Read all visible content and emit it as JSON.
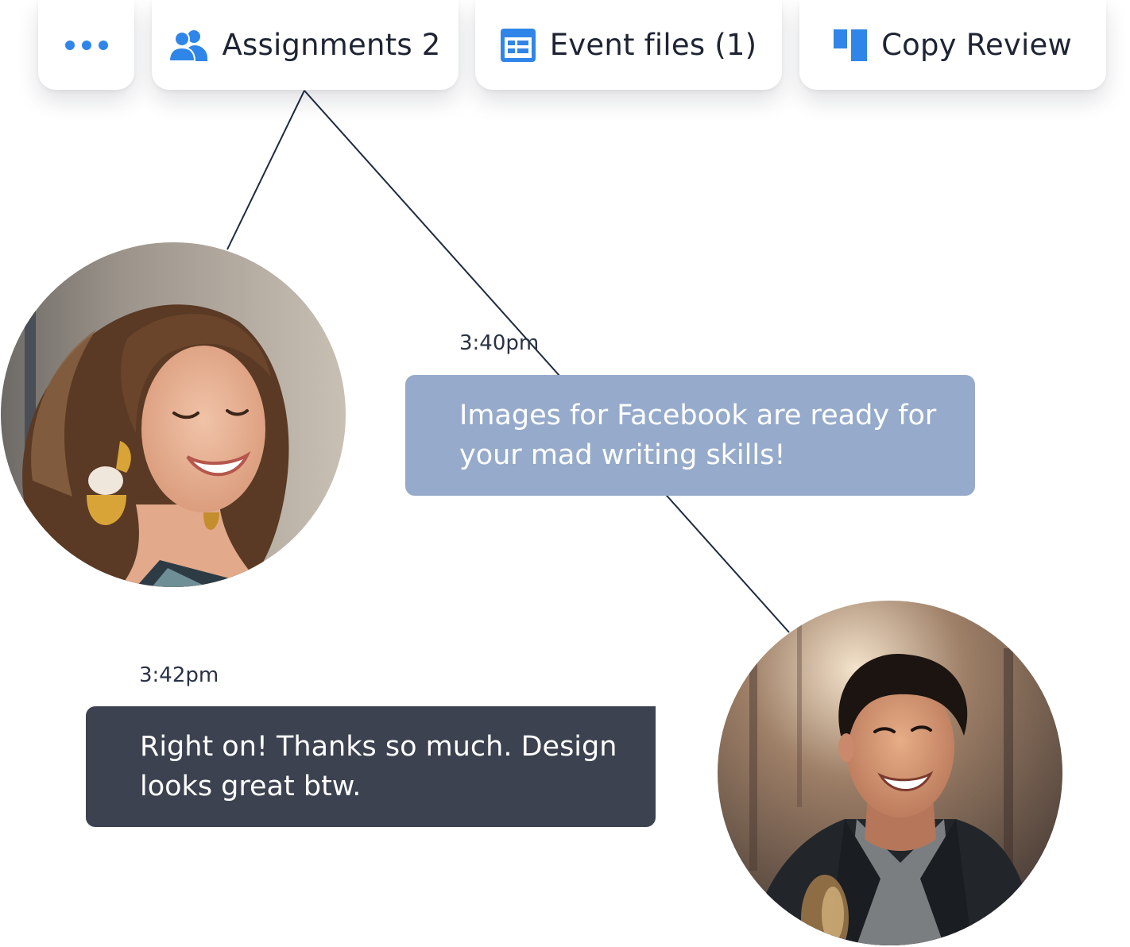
{
  "tabs": {
    "more": {
      "icon": "more-dots-icon"
    },
    "assignments": {
      "icon": "users-icon",
      "label": "Assignments 2"
    },
    "event_files": {
      "icon": "table-icon",
      "label": "Event files (1)"
    },
    "copy_review": {
      "icon": "columns-icon",
      "label": "Copy Review"
    }
  },
  "messages": [
    {
      "time": "3:40pm",
      "text": "Images for Facebook are ready for your mad writing skills!"
    },
    {
      "time": "3:42pm",
      "text": "Right on! Thanks so much. Design looks great btw."
    }
  ],
  "colors": {
    "accent_blue": "#2f86e8",
    "bubble_light": "#96abcb",
    "bubble_dark": "#3c4250",
    "line": "#1e2a40"
  }
}
